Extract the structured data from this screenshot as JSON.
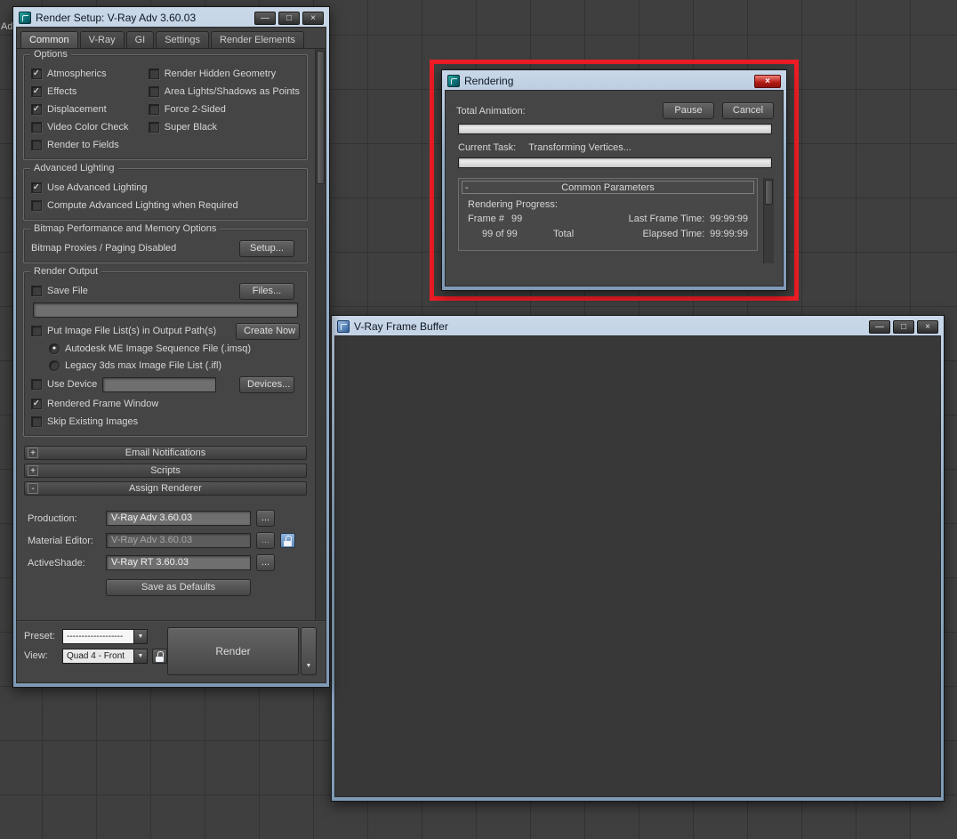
{
  "icons": {
    "minimize": "—",
    "maximize": "□",
    "close": "×",
    "check": "✓",
    "radio_dot": "●",
    "dropdown_arrow": "▼"
  },
  "background_fragment": "Adv",
  "render_setup": {
    "title": "Render Setup: V-Ray Adv 3.60.03",
    "tabs": [
      {
        "label": "Common"
      },
      {
        "label": "V-Ray"
      },
      {
        "label": "GI"
      },
      {
        "label": "Settings"
      },
      {
        "label": "Render Elements"
      }
    ],
    "options_group": {
      "title": "Options",
      "left": [
        {
          "label": "Atmospherics",
          "mark": "✓"
        },
        {
          "label": "Effects",
          "mark": "✓"
        },
        {
          "label": "Displacement",
          "mark": "✓"
        },
        {
          "label": "Video Color Check",
          "mark": ""
        },
        {
          "label": "Render to Fields",
          "mark": ""
        }
      ],
      "right": [
        {
          "label": "Render Hidden Geometry",
          "mark": ""
        },
        {
          "label": "Area Lights/Shadows as Points",
          "mark": ""
        },
        {
          "label": "Force 2-Sided",
          "mark": ""
        },
        {
          "label": "Super Black",
          "mark": ""
        }
      ]
    },
    "advanced_lighting_group": {
      "title": "Advanced Lighting",
      "items": [
        {
          "label": "Use Advanced Lighting",
          "mark": "✓"
        },
        {
          "label": "Compute Advanced Lighting when Required",
          "mark": ""
        }
      ]
    },
    "bitmap_group": {
      "title": "Bitmap Performance and Memory Options",
      "status": "Bitmap Proxies / Paging Disabled",
      "setup_button": "Setup..."
    },
    "render_output_group": {
      "title": "Render Output",
      "save_file": {
        "label": "Save File",
        "mark": ""
      },
      "files_button": "Files...",
      "image_file_list": {
        "label": "Put Image File List(s) in Output Path(s)",
        "mark": ""
      },
      "create_now_button": "Create Now",
      "radios": [
        {
          "label": "Autodesk ME Image Sequence File (.imsq)",
          "mark": "●"
        },
        {
          "label": "Legacy 3ds max Image File List (.ifl)",
          "mark": ""
        }
      ],
      "use_device": {
        "label": "Use Device",
        "mark": ""
      },
      "devices_button": "Devices...",
      "rendered_frame_window": {
        "label": "Rendered Frame Window",
        "mark": "✓"
      },
      "skip_existing": {
        "label": "Skip Existing Images",
        "mark": ""
      }
    },
    "rollouts": [
      {
        "state": "+",
        "title": "Email Notifications"
      },
      {
        "state": "+",
        "title": "Scripts"
      },
      {
        "state": "-",
        "title": "Assign Renderer"
      }
    ],
    "assign_renderer": {
      "rows": [
        {
          "label": "Production:",
          "value": "V-Ray Adv 3.60.03"
        },
        {
          "label": "Material Editor:",
          "value": "V-Ray Adv 3.60.03"
        },
        {
          "label": "ActiveShade:",
          "value": "V-Ray RT 3.60.03"
        }
      ],
      "browse_label": "...",
      "save_defaults_button": "Save as Defaults"
    },
    "footer": {
      "preset_label": "Preset:",
      "preset_value": "-------------------",
      "view_label": "View:",
      "view_value": "Quad 4 - Front",
      "render_button": "Render"
    }
  },
  "rendering_dialog": {
    "title": "Rendering",
    "total_animation_label": "Total Animation:",
    "pause_button": "Pause",
    "cancel_button": "Cancel",
    "current_task_label": "Current Task:",
    "current_task_value": "Transforming Vertices...",
    "common_parameters": {
      "collapse": "-",
      "title": "Common Parameters",
      "progress_label": "Rendering Progress:",
      "frame_label": "Frame #",
      "frame_value": "99",
      "last_frame_label": "Last Frame Time:",
      "last_frame_value": "99:99:99",
      "count": "99 of 99",
      "total_label": "Total",
      "elapsed_label": "Elapsed Time:",
      "elapsed_value": "99:99:99"
    }
  },
  "frame_buffer": {
    "title": "V-Ray Frame Buffer"
  }
}
